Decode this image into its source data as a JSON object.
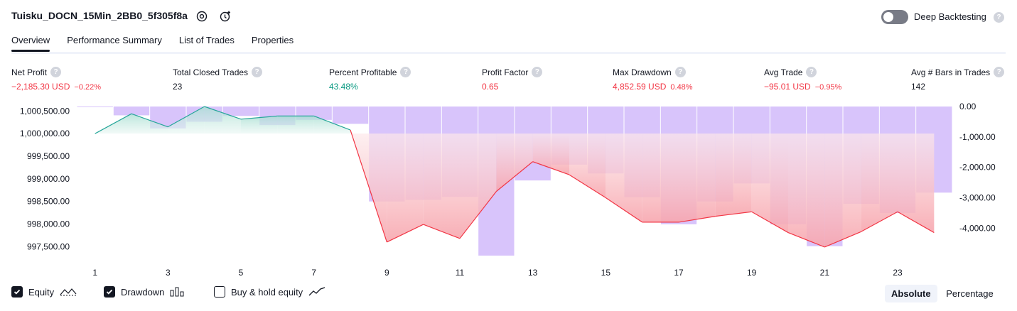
{
  "header": {
    "title": "Tuisku_DOCN_15Min_2BB0_5f305f8a",
    "deep_backtesting_label": "Deep Backtesting",
    "help_glyph": "?"
  },
  "tabs": [
    {
      "label": "Overview",
      "active": true
    },
    {
      "label": "Performance Summary",
      "active": false
    },
    {
      "label": "List of Trades",
      "active": false
    },
    {
      "label": "Properties",
      "active": false
    }
  ],
  "stats": [
    {
      "label": "Net Profit",
      "value": "−2,185.30 USD",
      "sub": "−0.22%",
      "tone": "neg"
    },
    {
      "label": "Total Closed Trades",
      "value": "23",
      "sub": "",
      "tone": "neu"
    },
    {
      "label": "Percent Profitable",
      "value": "43.48%",
      "sub": "",
      "tone": "pos"
    },
    {
      "label": "Profit Factor",
      "value": "0.65",
      "sub": "",
      "tone": "neg"
    },
    {
      "label": "Max Drawdown",
      "value": "4,852.59 USD",
      "sub": "0.48%",
      "tone": "neg"
    },
    {
      "label": "Avg Trade",
      "value": "−95.01 USD",
      "sub": "−0.95%",
      "tone": "neg"
    },
    {
      "label": "Avg # Bars in Trades",
      "value": "142",
      "sub": "",
      "tone": "neu"
    }
  ],
  "legend": {
    "equity": {
      "label": "Equity",
      "checked": true
    },
    "drawdown": {
      "label": "Drawdown",
      "checked": true
    },
    "buy_hold": {
      "label": "Buy & hold equity",
      "checked": false
    }
  },
  "mode": {
    "absolute": "Absolute",
    "percentage": "Percentage",
    "selected": "Absolute"
  },
  "colors": {
    "equity_line": "#26a69a",
    "equity_fill": "#dff3ee",
    "loss_line": "#f23645",
    "drawdown_bar": "#d8c4fb",
    "negative": "#f23645",
    "positive": "#089981"
  },
  "chart_data": {
    "type": "line",
    "x": [
      1,
      2,
      3,
      4,
      5,
      6,
      7,
      8,
      9,
      10,
      11,
      12,
      13,
      14,
      15,
      16,
      17,
      18,
      19,
      20,
      21,
      22,
      23,
      24
    ],
    "x_ticks": [
      "1",
      "3",
      "5",
      "7",
      "9",
      "11",
      "13",
      "15",
      "17",
      "19",
      "21",
      "23"
    ],
    "left_axis": {
      "ticks": [
        "1,000,500.00",
        "1,000,000.00",
        "999,500.00",
        "999,000.00",
        "998,500.00",
        "998,000.00",
        "997,500.00"
      ],
      "range": [
        997300,
        1000600
      ]
    },
    "right_axis": {
      "ticks": [
        "0.00",
        "-1,000.00",
        "-2,000.00",
        "-3,000.00",
        "-4,000.00"
      ],
      "range": [
        -4900,
        0
      ]
    },
    "series": [
      {
        "name": "Equity",
        "axis": "left",
        "values": [
          1000000,
          1000440,
          1000150,
          1000600,
          1000320,
          1000390,
          1000390,
          1000080,
          997600,
          997990,
          997680,
          998720,
          999380,
          999090,
          998580,
          998040,
          998040,
          998170,
          998270,
          997810,
          997490,
          997830,
          998270,
          997810
        ]
      },
      {
        "name": "Drawdown",
        "axis": "right",
        "type": "bar",
        "values": [
          -20,
          -290,
          -720,
          -500,
          -310,
          -610,
          -440,
          -570,
          -3120,
          -3070,
          -2970,
          -4900,
          -2430,
          -1910,
          -2200,
          -2980,
          -3870,
          -3120,
          -2530,
          -3870,
          -4590,
          -3200,
          -3500,
          -2830
        ]
      }
    ]
  }
}
